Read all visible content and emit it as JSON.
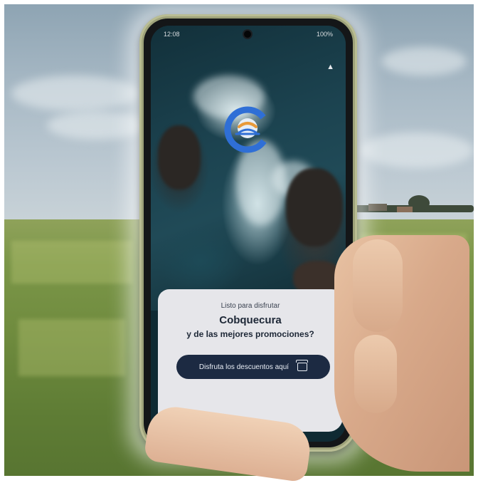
{
  "status_bar": {
    "time": "12:08",
    "battery": "100%"
  },
  "splash": {
    "subtitle": "Listo para disfrutar",
    "title": "Cobquecura",
    "tagline": "y de las mejores  promociones?",
    "cta_label": "Disfruta los descuentos aquí",
    "cta_icon": "store-icon"
  },
  "colors": {
    "card_background": "#e6e6ea",
    "cta_background": "#1c2a42",
    "logo_blue": "#2f6fd6",
    "logo_orange": "#e89a3a"
  }
}
